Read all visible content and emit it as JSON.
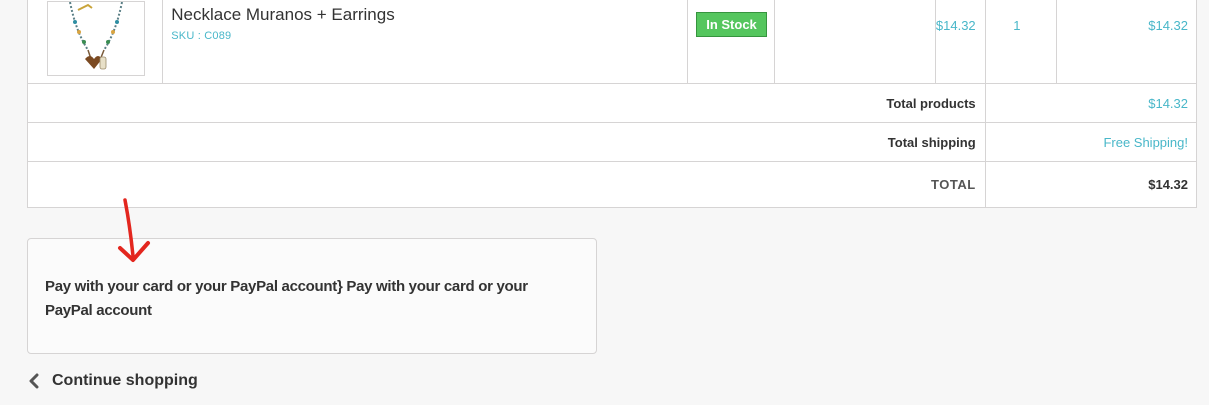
{
  "product": {
    "name": "Necklace Muranos + Earrings",
    "sku": "SKU : C089",
    "availability": "In Stock",
    "unit_price": "$14.32",
    "quantity": "1",
    "total": "$14.32"
  },
  "totals": {
    "products_label": "Total products",
    "products_value": "$14.32",
    "shipping_label": "Total shipping",
    "shipping_value": "Free Shipping!",
    "grand_label": "TOTAL",
    "grand_value": "$14.32"
  },
  "payment": {
    "text": "Pay with your card or your PayPal account} Pay with your card or your PayPal account"
  },
  "nav": {
    "continue_label": "Continue shopping",
    "continue_icon": "chevron-left-icon"
  },
  "colors": {
    "accent": "#49b7c9",
    "in_stock": "#55c65e",
    "annotation_arrow": "#e3261e"
  }
}
